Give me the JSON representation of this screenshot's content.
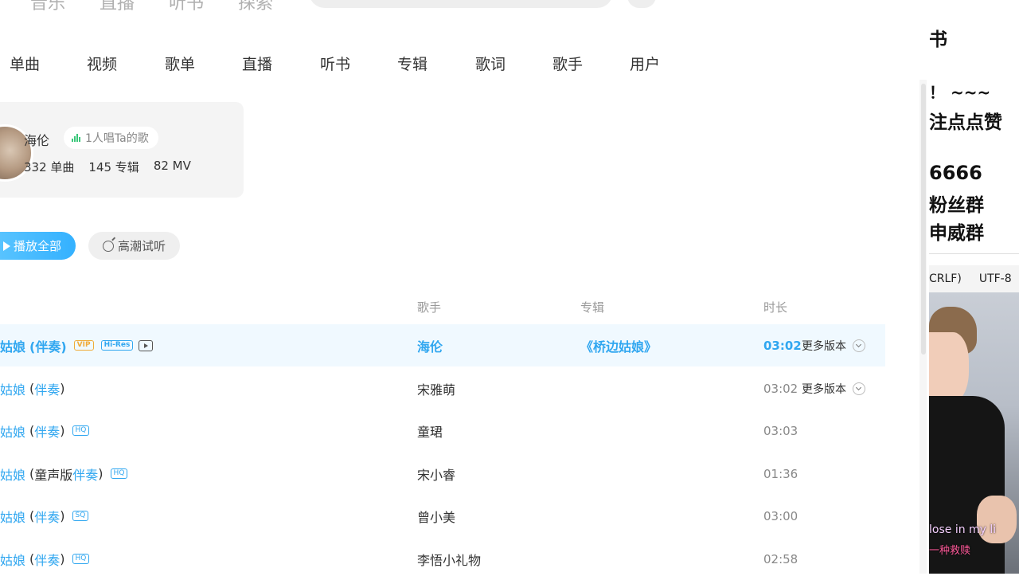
{
  "top_nav": [
    "音乐",
    "直播",
    "听书",
    "探索"
  ],
  "tabs": [
    "单曲",
    "视频",
    "歌单",
    "直播",
    "听书",
    "专辑",
    "歌词",
    "歌手",
    "用户"
  ],
  "artist": {
    "name": "海伦",
    "badge": "1人唱Ta的歌",
    "singles": "332 单曲",
    "albums": "145 专辑",
    "mvs": "82 MV"
  },
  "actions": {
    "play_all": "播放全部",
    "highlight_preview": "高潮试听"
  },
  "columns": {
    "singer": "歌手",
    "album": "专辑",
    "duration": "时长"
  },
  "songs": [
    {
      "title_prefix": "姑娘",
      "title_suffix": "(伴奏)",
      "tags": [
        "VIP",
        "Hi-Res"
      ],
      "singer": "海伦",
      "album": "《桥边姑娘》",
      "duration": "03:02",
      "more": "更多版本"
    },
    {
      "title_prefix": "姑娘",
      "title_suffix": "伴奏",
      "tags": [],
      "singer": "宋雅萌",
      "album": "",
      "duration": "03:02",
      "more": "更多版本"
    },
    {
      "title_prefix": "姑娘",
      "title_suffix": "伴奏",
      "tags": [
        "HQ"
      ],
      "singer": "童珺",
      "album": "",
      "duration": "03:03",
      "more": ""
    },
    {
      "title_prefix": "姑娘",
      "title_mid": "童声版",
      "title_suffix": "伴奏",
      "tags": [
        "HQ"
      ],
      "singer": "宋小睿",
      "album": "",
      "duration": "01:36",
      "more": ""
    },
    {
      "title_prefix": "姑娘",
      "title_suffix": "伴奏",
      "tags": [
        "SQ"
      ],
      "singer": "曾小美",
      "album": "",
      "duration": "03:00",
      "more": ""
    },
    {
      "title_prefix": "姑娘",
      "title_suffix": "伴奏",
      "tags": [
        "HQ"
      ],
      "singer": "李悟小礼物",
      "album": "",
      "duration": "02:58",
      "more": ""
    }
  ],
  "overlay": {
    "lines": [
      "书",
      "！ ~~~",
      "注点点赞",
      "6666",
      "粉丝群",
      "申威群"
    ],
    "status": [
      "CRLF)",
      "UTF-8"
    ],
    "caption": "lose in my li",
    "caption2": "一种救赎"
  },
  "colors": {
    "accent": "#31a7f0",
    "play_gradient_start": "#5fc7ff",
    "play_gradient_end": "#34b1ff",
    "vip": "#f0ab3a",
    "active_row_bg": "#f0f9ff"
  }
}
